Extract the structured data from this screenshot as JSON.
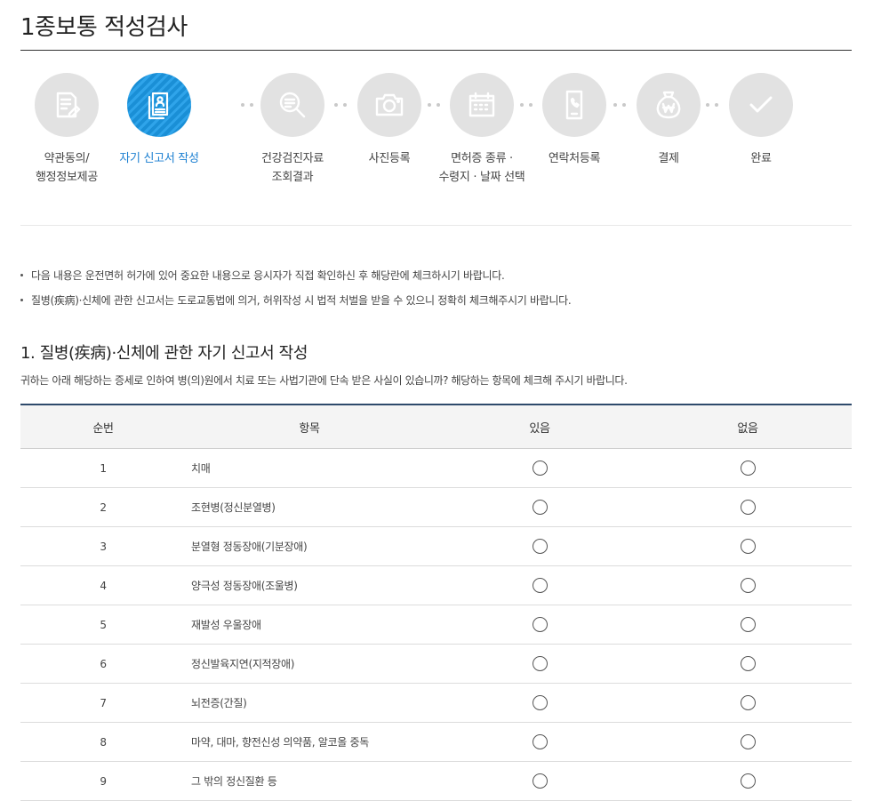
{
  "page": {
    "title": "1종보통 적성검사"
  },
  "steps": [
    {
      "label": "약관동의/\n행정정보제공",
      "icon": "document-edit-icon",
      "active": false
    },
    {
      "label": "자기 신고서 작성",
      "icon": "self-report-icon",
      "active": true
    },
    {
      "label": "건강검진자료\n조회결과",
      "icon": "search-document-icon",
      "active": false
    },
    {
      "label": "사진등록",
      "icon": "camera-icon",
      "active": false
    },
    {
      "label": "면허증 종류 ·\n수령지 · 날짜 선택",
      "icon": "calendar-icon",
      "active": false
    },
    {
      "label": "연락처등록",
      "icon": "phone-icon",
      "active": false
    },
    {
      "label": "결제",
      "icon": "won-bag-icon",
      "active": false
    },
    {
      "label": "완료",
      "icon": "check-icon",
      "active": false
    }
  ],
  "notices": [
    "다음 내용은 운전면허 허가에 있어 중요한 내용으로 응시자가 직접 확인하신 후 해당란에 체크하시기 바랍니다.",
    "질병(疾病)·신체에 관한 신고서는 도로교통법에 의거, 허위작성 시 법적 처벌을 받을 수 있으니 정확히 체크해주시기 바랍니다."
  ],
  "section": {
    "title": "1. 질병(疾病)·신체에 관한 자기 신고서 작성",
    "description": "귀하는 아래 해당하는 증세로 인하여 병(의)원에서 치료 또는 사법기관에 단속 받은 사실이 있습니까? 해당하는 항목에 체크해 주시기 바랍니다."
  },
  "table": {
    "headers": {
      "no": "순번",
      "item": "항목",
      "yes": "있음",
      "no_answer": "없음"
    },
    "rows": [
      {
        "no": "1",
        "item": "치매"
      },
      {
        "no": "2",
        "item": "조현병(정신분열병)"
      },
      {
        "no": "3",
        "item": "분열형 정동장애(기분장애)"
      },
      {
        "no": "4",
        "item": "양극성 정동장애(조울병)"
      },
      {
        "no": "5",
        "item": "재발성 우울장애"
      },
      {
        "no": "6",
        "item": "정신발육지연(지적장애)"
      },
      {
        "no": "7",
        "item": "뇌전증(간질)"
      },
      {
        "no": "8",
        "item": "마약, 대마, 향전신성 의약품, 알코올 중독"
      },
      {
        "no": "9",
        "item": "그 밖의 정신질환 등"
      }
    ]
  },
  "colors": {
    "active_step": "#1a8fd6",
    "inactive_step": "#e2e2e2",
    "table_top_border": "#2e4a6b"
  }
}
